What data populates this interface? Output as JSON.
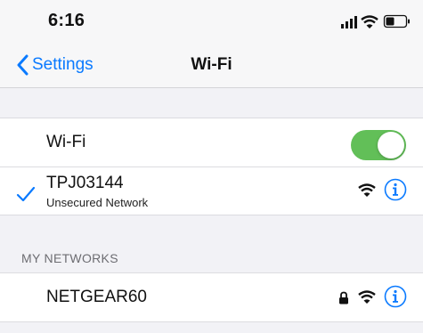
{
  "status_bar": {
    "time": "6:16"
  },
  "nav": {
    "back_label": "Settings",
    "title": "Wi-Fi"
  },
  "wifi_toggle": {
    "label": "Wi-Fi",
    "on": true
  },
  "connected_network": {
    "name": "TPJ03144",
    "subtitle": "Unsecured Network"
  },
  "my_networks": {
    "header": "MY NETWORKS",
    "items": [
      {
        "name": "NETGEAR60",
        "secured": true
      }
    ]
  },
  "colors": {
    "accent": "#0a7aff",
    "toggle_on": "#62bf58",
    "background": "#f2f2f6"
  },
  "icons": [
    "signal-icon",
    "wifi-icon",
    "battery-icon",
    "chevron-left-icon",
    "checkmark-icon",
    "lock-icon",
    "info-icon"
  ]
}
